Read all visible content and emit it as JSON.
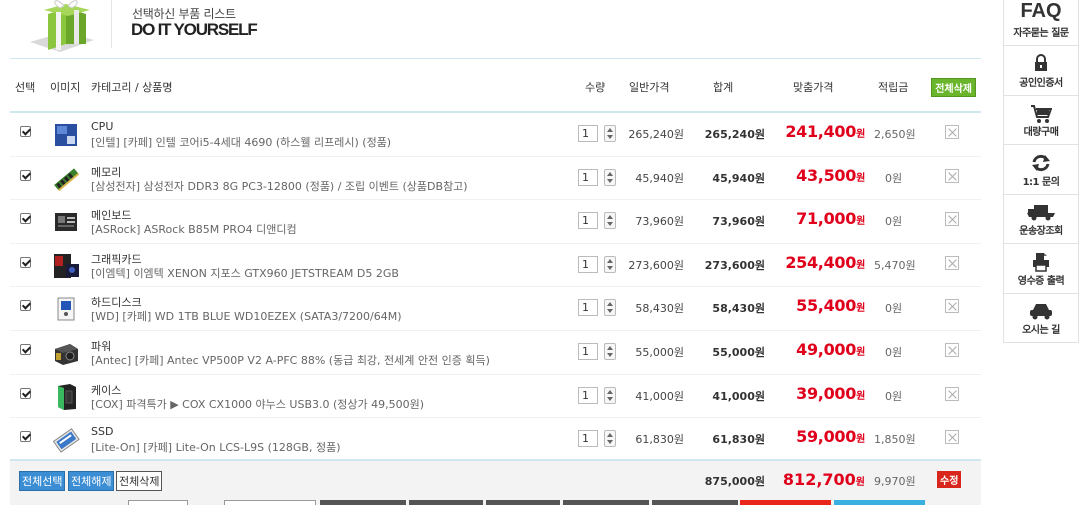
{
  "header": {
    "subtitle": "선택하신 부품 리스트",
    "title": "DO IT YOURSELF"
  },
  "columns": {
    "select": "선택",
    "image": "이미지",
    "name": "카테고리 / 상품명",
    "qty": "수량",
    "price": "일반가격",
    "total": "합계",
    "fit": "맞춤가격",
    "points": "적립금",
    "delete_all": "전체삭제"
  },
  "won": "원",
  "items": [
    {
      "category": "CPU",
      "name": "[인텔] [카페] 인텔 코어i5-4세대 4690 (하스웰 리프레시) (정품)",
      "qty": "1",
      "price": "265,240원",
      "total": "265,240원",
      "fit": "241,400",
      "points": "2,650원",
      "thumb": "cpu-box"
    },
    {
      "category": "메모리",
      "name": "[삼성전자] 삼성전자 DDR3 8G PC3-12800 (정품) / 조립 이벤트 (상품DB참고)",
      "qty": "1",
      "price": "45,940원",
      "total": "45,940원",
      "fit": "43,500",
      "points": "0원",
      "thumb": "ram"
    },
    {
      "category": "메인보드",
      "name": "[ASRock] ASRock B85M PRO4 디앤디컴",
      "qty": "1",
      "price": "73,960원",
      "total": "73,960원",
      "fit": "71,000",
      "points": "0원",
      "thumb": "motherboard"
    },
    {
      "category": "그래픽카드",
      "name": "[이엠텍] 이엠텍 XENON 지포스 GTX960 JETSTREAM D5 2GB",
      "qty": "1",
      "price": "273,600원",
      "total": "273,600원",
      "fit": "254,400",
      "points": "5,470원",
      "thumb": "gpu-box"
    },
    {
      "category": "하드디스크",
      "name": "[WD] [카페] WD 1TB BLUE WD10EZEX (SATA3/7200/64M)",
      "qty": "1",
      "price": "58,430원",
      "total": "58,430원",
      "fit": "55,400",
      "points": "0원",
      "thumb": "hdd"
    },
    {
      "category": "파워",
      "name": "[Antec] [카페] Antec VP500P V2 A-PFC 88% (동급 최강, 전세계 안전 인증 획득)",
      "qty": "1",
      "price": "55,000원",
      "total": "55,000원",
      "fit": "49,000",
      "points": "0원",
      "thumb": "psu"
    },
    {
      "category": "케이스",
      "name": "[COX] 파격특가 ▶ COX CX1000 야누스 USB3.0 (정상가 49,500원)",
      "qty": "1",
      "price": "41,000원",
      "total": "41,000원",
      "fit": "39,000",
      "points": "0원",
      "thumb": "case"
    },
    {
      "category": "SSD",
      "name": "[Lite-On] [카페] Lite-On LCS-L9S (128GB, 정품)",
      "qty": "1",
      "price": "61,830원",
      "total": "61,830원",
      "fit": "59,000",
      "points": "1,850원",
      "thumb": "ssd"
    }
  ],
  "footer": {
    "select_all": "전체선택",
    "deselect_all": "전체해제",
    "delete_all": "전체삭제",
    "total": "875,000원",
    "fit": "812,700",
    "points": "9,970원",
    "edit": "수정"
  },
  "sidebar": [
    {
      "label": "자주묻는 질문",
      "icon": "faq-icon",
      "icon_text": "FAQ"
    },
    {
      "label": "공인인증서",
      "icon": "lock-icon"
    },
    {
      "label": "대량구매",
      "icon": "cart-icon"
    },
    {
      "label": "1:1 문의",
      "icon": "refresh-icon"
    },
    {
      "label": "운송장조회",
      "icon": "truck-icon"
    },
    {
      "label": "영수증 출력",
      "icon": "printer-icon"
    },
    {
      "label": "오시는 길",
      "icon": "car-icon"
    }
  ],
  "colors": {
    "accent_red": "#e0001b",
    "border_blue": "#cfe8ef",
    "green": "#6bb52c",
    "blue_btn": "#3c8ed4"
  }
}
